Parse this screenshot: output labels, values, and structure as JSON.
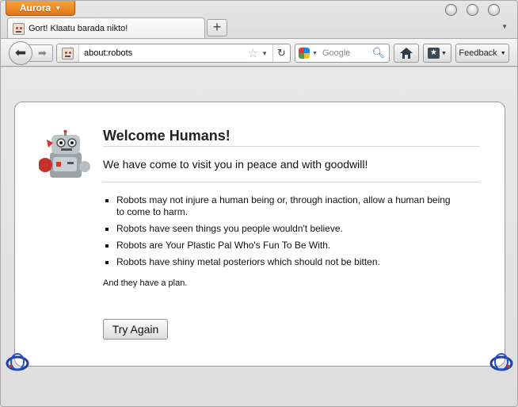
{
  "app_menu": {
    "label": "Aurora"
  },
  "tab": {
    "title": "Gort! Klaatu barada nikto!"
  },
  "navbar": {
    "url": "about:robots",
    "search_placeholder": "Google",
    "feedback_label": "Feedback"
  },
  "page": {
    "title": "Welcome Humans!",
    "subtitle": "We have come to visit you in peace and with goodwill!",
    "laws": [
      "Robots may not injure a human being or, through inaction, allow a human being to come to harm.",
      "Robots have seen things you people wouldn't believe.",
      "Robots are Your Plastic Pal Who's Fun To Be With.",
      "Robots have shiny metal posteriors which should not be bitten."
    ],
    "plan": "And they have a plan.",
    "try_again_label": "Try Again"
  },
  "colors": {
    "app_button": "#e8891f",
    "ring_blue": "#1f3fa8",
    "robot_red": "#c0392b"
  },
  "icons": [
    "back-arrow-icon",
    "forward-arrow-icon",
    "star-icon",
    "reload-icon",
    "google-icon",
    "search-icon",
    "home-icon",
    "bookmarks-icon",
    "robot-icon"
  ]
}
